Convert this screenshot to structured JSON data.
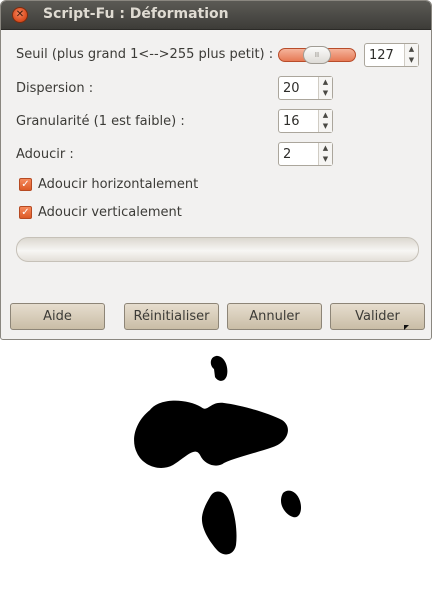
{
  "window": {
    "title": "Script-Fu : Déformation",
    "close_glyph": "✕"
  },
  "threshold": {
    "label": "Seuil (plus grand 1<-->255 plus petit) :",
    "value": "127",
    "slider_fraction": 0.5
  },
  "dispersion": {
    "label": "Dispersion :",
    "value": "20"
  },
  "granularity": {
    "label": "Granularité (1 est faible) :",
    "value": "16"
  },
  "smooth": {
    "label": "Adoucir :",
    "value": "2"
  },
  "smooth_horizontal": {
    "label": "Adoucir horizontalement",
    "checked": true
  },
  "smooth_vertical": {
    "label": "Adoucir verticalement",
    "checked": true
  },
  "spin_glyphs": {
    "up": "▲",
    "down": "▼",
    "check": "✓",
    "grip": "II"
  },
  "buttons": {
    "help": "Aide",
    "reset": "Réinitialiser",
    "cancel": "Annuler",
    "ok": "Valider"
  },
  "colors": {
    "accent": "#e0602e",
    "titlebar": "#3d3c38",
    "dialog_bg": "#f2f1f0",
    "button": "#d6ccb8",
    "blob": "#000000"
  },
  "icons": [
    "close-icon",
    "spin-up-icon",
    "spin-down-icon",
    "checkmark-icon",
    "mouse-pointer-icon"
  ]
}
